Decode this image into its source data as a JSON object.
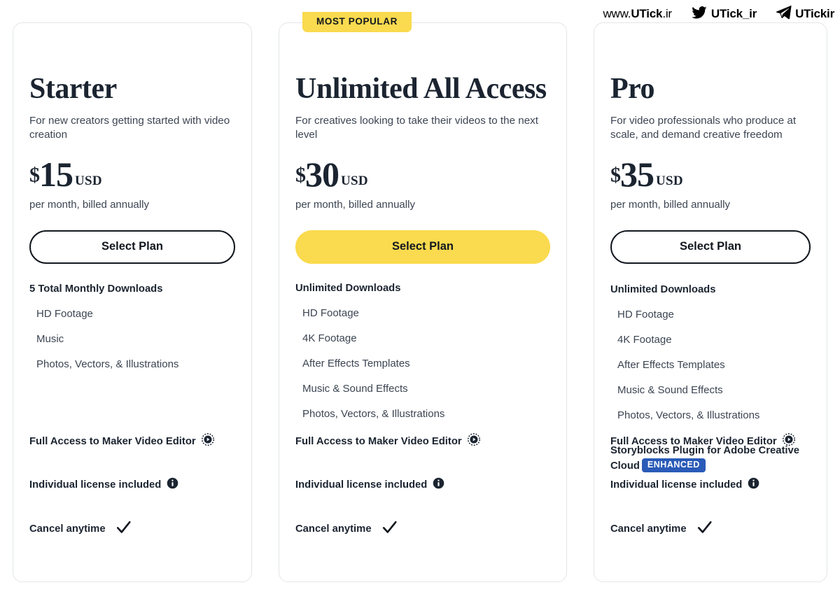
{
  "watermark": {
    "site": {
      "prefix": "www.",
      "brand": "UTick",
      "suffix": ".ir"
    },
    "twitter": {
      "icon": "twitter-bird-icon",
      "handle": "UTick_ir"
    },
    "telegram": {
      "icon": "telegram-plane-icon",
      "handle": "UTickir"
    }
  },
  "badge": {
    "most_popular": "MOST POPULAR",
    "enhanced": "ENHANCED"
  },
  "colors": {
    "accent_yellow": "#fada4e",
    "badge_blue": "#2a5bb8",
    "text_dark": "#1b2430",
    "text_body": "#3c4552",
    "card_border": "#e3e5e8"
  },
  "plans": [
    {
      "name": "Starter",
      "description": "For new creators getting started with video creation",
      "currency_symbol": "$",
      "price": "15",
      "currency_code": "USD",
      "billing_note": "per month, billed annually",
      "cta_label": "Select Plan",
      "cta_style": "outline",
      "featured": false,
      "downloads_heading": "5 Total Monthly Downloads",
      "features": [
        "HD Footage",
        "Music",
        "Photos, Vectors, & Illustrations"
      ],
      "extra_feature": null,
      "footer": [
        {
          "label": "Full Access to Maker Video Editor",
          "icon": "play-record-icon"
        },
        {
          "label": "Individual license included",
          "icon": "info-circle-icon"
        },
        {
          "label": "Cancel anytime",
          "icon": "check-icon"
        }
      ]
    },
    {
      "name": "Unlimited All Access",
      "description": "For creatives looking to take their videos to the next level",
      "currency_symbol": "$",
      "price": "30",
      "currency_code": "USD",
      "billing_note": "per month, billed annually",
      "cta_label": "Select Plan",
      "cta_style": "solid",
      "featured": true,
      "downloads_heading": "Unlimited Downloads",
      "features": [
        "HD Footage",
        "4K Footage",
        "After Effects Templates",
        "Music & Sound Effects",
        "Photos, Vectors, & Illustrations"
      ],
      "extra_feature": null,
      "footer": [
        {
          "label": "Full Access to Maker Video Editor",
          "icon": "play-record-icon"
        },
        {
          "label": "Individual license included",
          "icon": "info-circle-icon"
        },
        {
          "label": "Cancel anytime",
          "icon": "check-icon"
        }
      ]
    },
    {
      "name": "Pro",
      "description": "For video professionals who produce at scale, and demand creative freedom",
      "currency_symbol": "$",
      "price": "35",
      "currency_code": "USD",
      "billing_note": "per month, billed annually",
      "cta_label": "Select Plan",
      "cta_style": "outline",
      "featured": false,
      "downloads_heading": "Unlimited Downloads",
      "features": [
        "HD Footage",
        "4K Footage",
        "After Effects Templates",
        "Music & Sound Effects",
        "Photos, Vectors, & Illustrations"
      ],
      "extra_feature": "Storyblocks Plugin for Adobe Creative Cloud",
      "footer": [
        {
          "label": "Full Access to Maker Video Editor",
          "icon": "play-record-icon"
        },
        {
          "label": "Individual license included",
          "icon": "info-circle-icon"
        },
        {
          "label": "Cancel anytime",
          "icon": "check-icon"
        }
      ]
    }
  ]
}
